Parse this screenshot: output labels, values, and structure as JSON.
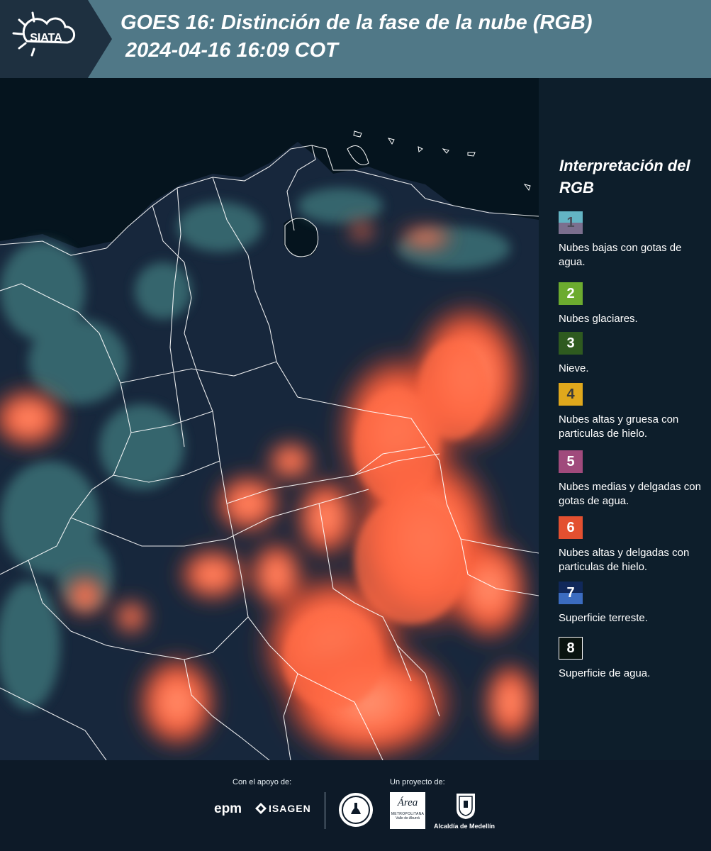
{
  "header": {
    "title_line1": "GOES 16: Distinción de la fase de la nube (RGB)",
    "title_line2": "2024-04-16 16:09 COT",
    "logo_text": "SIATA",
    "bg_color": "#507887"
  },
  "map": {
    "icon": "satellite-rgb-image",
    "colors": {
      "ocean": "#05141e",
      "land": "#16263d",
      "cloud_hot": "#ff5a38",
      "cloud_mid": "#f0785a",
      "low_cloud": "#4f8c8c",
      "borders": "#ffffff"
    }
  },
  "legend": {
    "title": "Interpretación del RGB",
    "items": [
      {
        "number": "1",
        "label": "Nubes bajas con gotas de agua.",
        "color_top": "#63b4c4",
        "color_bottom": "#7b6f8e",
        "num_color": "#4d4d5a"
      },
      {
        "number": "2",
        "label": "Nubes glaciares.",
        "color_top": "#6cab2f",
        "color_bottom": "#6cab2f",
        "num_color": "#ffffff"
      },
      {
        "number": "3",
        "label": "Nieve.",
        "color_top": "#2e5a1f",
        "color_bottom": "#2e5a1f",
        "num_color": "#ffffff"
      },
      {
        "number": "4",
        "label": "Nubes altas y gruesa con particulas de hielo.",
        "color_top": "#e0a81c",
        "color_bottom": "#e0a81c",
        "num_color": "#3a3a3a"
      },
      {
        "number": "5",
        "label": "Nubes medias y delgadas con gotas de agua.",
        "color_top": "#a04a7c",
        "color_bottom": "#a04a7c",
        "num_color": "#ffffff"
      },
      {
        "number": "6",
        "label": "Nubes altas y delgadas con particulas de hielo.",
        "color_top": "#e35030",
        "color_bottom": "#e35030",
        "num_color": "#ffffff"
      },
      {
        "number": "7",
        "label": "Superficie terreste.",
        "color_top": "#10285a",
        "color_bottom": "#3b6cc0",
        "num_color": "#ffffff"
      },
      {
        "number": "8",
        "label": "Superficie de agua.",
        "color_top": "#0a1410",
        "color_bottom": "#0a1410",
        "num_color": "#ffffff"
      }
    ]
  },
  "footer": {
    "support_label": "Con el apoyo de:",
    "project_label": "Un proyecto de:",
    "epm_text": "epm",
    "isagen_text": "ISAGEN",
    "area_text": "Área",
    "area_sub": "METROPOLITANA",
    "area_sub2": "Valle de Aburrá",
    "alcaldia_text": "Alcaldía de Medellín"
  }
}
